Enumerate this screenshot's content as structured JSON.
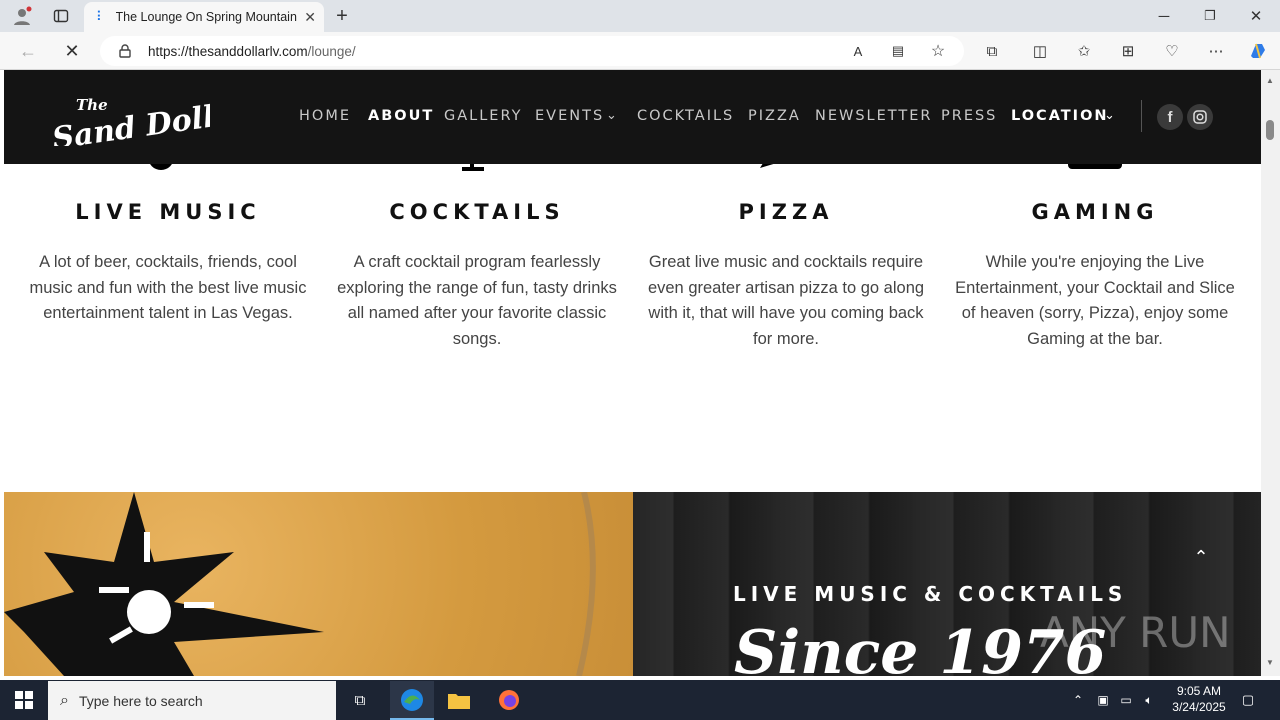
{
  "browser": {
    "tab_title": "The Lounge On Spring Mountain",
    "url_host": "https://thesanddollarlv.com",
    "url_path": "/lounge/"
  },
  "site": {
    "logo_text": "The Sand Dollar",
    "nav": [
      "HOME",
      "ABOUT",
      "GALLERY",
      "EVENTS",
      "COCKTAILS",
      "PIZZA",
      "NEWSLETTER",
      "PRESS",
      "LOCATION"
    ]
  },
  "features": [
    {
      "title": "LIVE MUSIC",
      "text": "A lot of beer, cocktails, friends, cool music and fun with the best live music entertainment talent in Las Vegas.",
      "icon": "guitar-icon"
    },
    {
      "title": "COCKTAILS",
      "text": "A craft cocktail program fearlessly exploring the range of fun, tasty drinks all named after your favorite classic songs.",
      "icon": "cocktail-icon"
    },
    {
      "title": "PIZZA",
      "text": "Great live music and cocktails require even greater artisan pizza to go along with it, that will have you coming back for more.",
      "icon": "pizza-icon"
    },
    {
      "title": "GAMING",
      "text": "While you're enjoying the Live Entertainment, your Cocktail and Slice of heaven (sorry, Pizza), enjoy some Gaming at the bar.",
      "icon": "slot-machine-icon"
    }
  ],
  "banner": {
    "subtitle": "LIVE MUSIC & COCKTAILS",
    "script_title": "Since 1976",
    "watermark": "ANY RUN"
  },
  "taskbar": {
    "search_placeholder": "Type here to search",
    "time": "9:05 AM",
    "date": "3/24/2025"
  }
}
